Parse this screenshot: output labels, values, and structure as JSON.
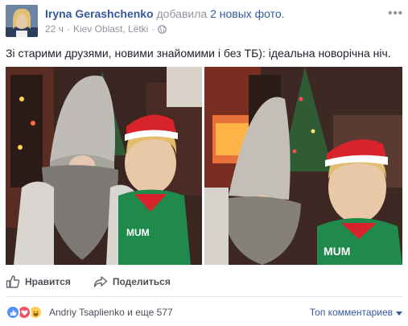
{
  "post": {
    "author": "Iryna Gerashchenko",
    "action_text": "добавила",
    "photos_link": "2 новых фото.",
    "time": "22 ч",
    "location": "Kiev Oblast, Lëtki",
    "separator": "·",
    "text": "Зі старими друзями, новими знайомими і без ТБ): ідеальна новорічна ніч.",
    "more_icon": "ellipsis-icon",
    "privacy_icon": "globe-icon"
  },
  "photos": [
    {
      "description_icon": "photo"
    },
    {
      "description_icon": "photo"
    }
  ],
  "actions": {
    "like_label": "Нравится",
    "share_label": "Поделиться"
  },
  "reactions": {
    "summary": "Andriy Tsaplienko и еще 577",
    "types": [
      "like",
      "love",
      "haha"
    ]
  },
  "comments": {
    "sort_label": "Топ комментариев"
  },
  "colors": {
    "link": "#365899",
    "meta": "#90949c",
    "like_blue": "#5890ff",
    "love_red": "#f25268",
    "haha_yellow": "#fcd24f"
  }
}
